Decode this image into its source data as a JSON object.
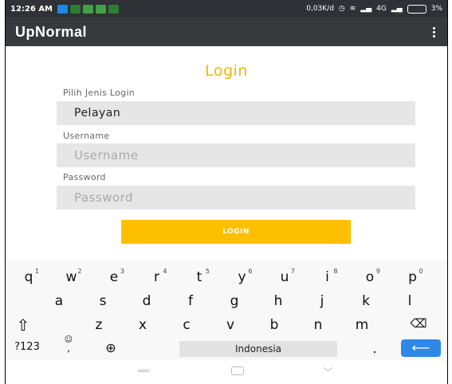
{
  "statusbar": {
    "time": "12:26 AM",
    "notifications": [
      {
        "icon": "twitter-notification-icon",
        "color": "#1e88e5"
      },
      {
        "icon": "message-notification-icon",
        "color": "#2e7d32"
      },
      {
        "icon": "app-notification-icon",
        "color": "#43a047"
      },
      {
        "icon": "app-notification-icon",
        "color": "#43a047"
      },
      {
        "icon": "app-notification-icon",
        "color": "#2e7d32"
      }
    ],
    "speed": "0,03K/d",
    "network": "4G",
    "battery": "3%"
  },
  "appbar": {
    "title": "UpNormal"
  },
  "login": {
    "title": "Login",
    "type_label": "Pilih Jenis Login",
    "type_value": "Pelayan",
    "username_label": "Username",
    "username_placeholder": "Username",
    "password_label": "Password",
    "password_placeholder": "Password",
    "button_label": "LOGIN"
  },
  "keyboard": {
    "row1": [
      {
        "k": "q",
        "n": "1"
      },
      {
        "k": "w",
        "n": "2"
      },
      {
        "k": "e",
        "n": "3"
      },
      {
        "k": "r",
        "n": "4"
      },
      {
        "k": "t",
        "n": "5"
      },
      {
        "k": "y",
        "n": "6"
      },
      {
        "k": "u",
        "n": "7"
      },
      {
        "k": "i",
        "n": "8"
      },
      {
        "k": "o",
        "n": "9"
      },
      {
        "k": "p",
        "n": "0"
      }
    ],
    "row2": [
      "a",
      "s",
      "d",
      "f",
      "g",
      "h",
      "j",
      "k",
      "l"
    ],
    "row3": [
      "z",
      "x",
      "c",
      "v",
      "b",
      "n",
      "m"
    ],
    "symbols_label": "?123",
    "comma": ",",
    "period": ".",
    "space_label": "Indonesia"
  },
  "colors": {
    "accent": "#fcc000",
    "title": "#f2b705",
    "appbar": "#38393d",
    "enter": "#2f87e6"
  }
}
